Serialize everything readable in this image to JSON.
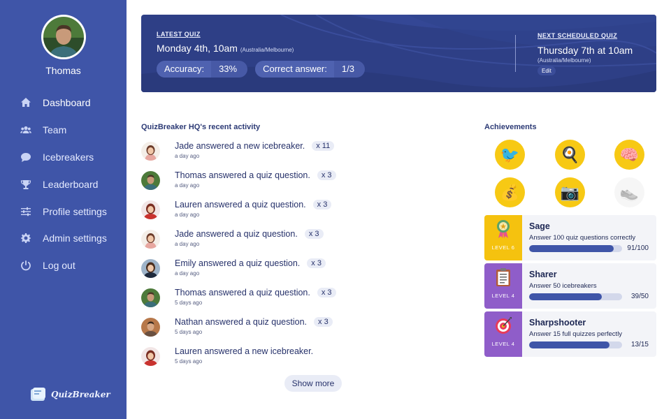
{
  "user": {
    "name": "Thomas"
  },
  "nav": [
    {
      "label": "Dashboard",
      "icon": "home-icon",
      "active": true
    },
    {
      "label": "Team",
      "icon": "users-icon"
    },
    {
      "label": "Icebreakers",
      "icon": "chat-bubble-icon"
    },
    {
      "label": "Leaderboard",
      "icon": "trophy-icon"
    },
    {
      "label": "Profile settings",
      "icon": "sliders-icon"
    },
    {
      "label": "Admin settings",
      "icon": "gear-icon"
    },
    {
      "label": "Log out",
      "icon": "power-icon"
    }
  ],
  "brand": {
    "name": "QuizBreaker"
  },
  "banner": {
    "latest_title": "LATEST QUIZ",
    "latest_date": "Monday 4th, 10am",
    "latest_tz": "(Australia/Melbourne)",
    "accuracy_label": "Accuracy:",
    "accuracy_value": "33%",
    "correct_label": "Correct answer:",
    "correct_value": "1/3",
    "next_title": "NEXT SCHEDULED QUIZ",
    "next_date": "Thursday 7th at 10am",
    "next_tz": "(Australia/Melbourne)",
    "edit_label": "Edit"
  },
  "activity": {
    "title": "QuizBreaker HQ's recent activity",
    "items": [
      {
        "text": "Jade answered a new icebreaker.",
        "count": "x 11",
        "time": "a day ago",
        "avatar": "jade"
      },
      {
        "text": "Thomas answered a quiz question.",
        "count": "x 3",
        "time": "a day ago",
        "avatar": "thomas"
      },
      {
        "text": "Lauren answered a quiz question.",
        "count": "x 3",
        "time": "a day ago",
        "avatar": "lauren"
      },
      {
        "text": "Jade answered a quiz question.",
        "count": "x 3",
        "time": "a day ago",
        "avatar": "jade"
      },
      {
        "text": "Emily answered a quiz question.",
        "count": "x 3",
        "time": "a day ago",
        "avatar": "emily"
      },
      {
        "text": "Thomas answered a quiz question.",
        "count": "x 3",
        "time": "5 days ago",
        "avatar": "thomas"
      },
      {
        "text": "Nathan answered a quiz question.",
        "count": "x 3",
        "time": "5 days ago",
        "avatar": "nathan"
      },
      {
        "text": "Lauren answered a new icebreaker.",
        "count": "",
        "time": "5 days ago",
        "avatar": "lauren"
      }
    ],
    "show_more_label": "Show more"
  },
  "achievements": {
    "title": "Achievements",
    "badges": [
      {
        "icon": "bird-icon",
        "glyph": "🐦",
        "earned": true
      },
      {
        "icon": "egg-icon",
        "glyph": "🍳",
        "earned": true
      },
      {
        "icon": "brain-icon",
        "glyph": "🧠",
        "earned": true
      },
      {
        "icon": "money-bag-icon",
        "glyph": "💰",
        "earned": true
      },
      {
        "icon": "camera-icon",
        "glyph": "📷",
        "earned": true
      },
      {
        "icon": "sneaker-icon",
        "glyph": "👟",
        "earned": false
      }
    ],
    "cards": [
      {
        "name": "Sage",
        "desc": "Answer 100 quiz questions correctly",
        "level": "LEVEL 6",
        "score": "91/100",
        "progress": 0.91,
        "color": "#f5c20f",
        "icon": "rosette-icon"
      },
      {
        "name": "Sharer",
        "desc": "Answer 50 icebreakers",
        "level": "LEVEL 4",
        "score": "39/50",
        "progress": 0.78,
        "color": "#8f5dc9",
        "icon": "clipboard-icon"
      },
      {
        "name": "Sharpshooter",
        "desc": "Answer 15 full quizzes perfectly",
        "level": "LEVEL 4",
        "score": "13/15",
        "progress": 0.867,
        "color": "#8f5dc9",
        "icon": "target-icon"
      }
    ]
  }
}
